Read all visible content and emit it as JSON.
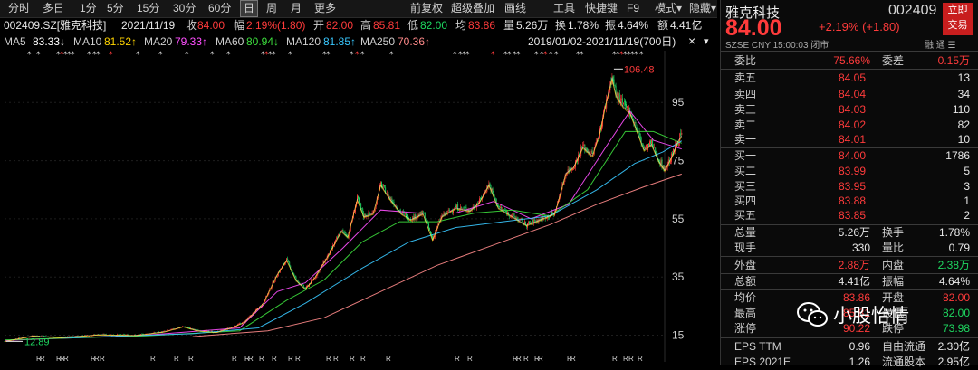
{
  "toolbar": {
    "periods": [
      "分时",
      "多日",
      "1分",
      "5分",
      "15分",
      "30分",
      "60分",
      "日",
      "周",
      "月",
      "更多"
    ],
    "tools": [
      "前复权",
      "超级叠加",
      "画线",
      "工具",
      "快捷键",
      "F9",
      "模式▾",
      "隐藏▾"
    ]
  },
  "info": {
    "code_name": "002409.SZ[雅克科技]",
    "date": "2021/11/19",
    "close_label": "收",
    "close": "84.00",
    "change_label": "幅",
    "change": "2.19%(1.80)",
    "open_label": "开",
    "open": "82.00",
    "high_label": "高",
    "high": "85.81",
    "low_label": "低",
    "low": "82.00",
    "avg_label": "均",
    "avg": "83.86",
    "volume_label": "量",
    "volume": "5.26万",
    "turnover_label": "换",
    "turnover": "1.78%",
    "amplitude_label": "振",
    "amplitude": "4.64%",
    "amount_label": "额",
    "amount": "4.41亿",
    "range": "2019/01/02-2021/11/19(700日)"
  },
  "ma": [
    {
      "label": "MA5",
      "value": "83.33↓"
    },
    {
      "label": "MA10",
      "value": "81.52↑"
    },
    {
      "label": "MA20",
      "value": "79.33↑"
    },
    {
      "label": "MA60",
      "value": "80.94↓"
    },
    {
      "label": "MA120",
      "value": "81.85↑"
    },
    {
      "label": "MA250",
      "value": "70.36↑"
    }
  ],
  "icons": {
    "close": "×",
    "chevron": "▾",
    "collapse": "»"
  },
  "colors": {
    "up": "#ff3b3b",
    "down": "#1ed760",
    "ma5": "#ffffff",
    "ma10": "#ffd400",
    "ma20": "#ff4fff",
    "ma60": "#3cdc3c",
    "ma120": "#39c8ff",
    "ma250": "#ff8a8a"
  },
  "chart_data": {
    "type": "candlestick",
    "y_ticks": [
      15,
      35,
      55,
      75,
      95
    ],
    "ylim": [
      10.5,
      110
    ],
    "x_range": [
      "2019/01/02",
      "2021/11/19"
    ],
    "trading_days": 700,
    "annotations": {
      "max": "106.48",
      "min": "12.89"
    },
    "price_path": [
      [
        0,
        12.9
      ],
      [
        30,
        14.8
      ],
      [
        60,
        14.2
      ],
      [
        100,
        15.2
      ],
      [
        140,
        15.0
      ],
      [
        170,
        16.2
      ],
      [
        190,
        18.0
      ],
      [
        205,
        16.6
      ],
      [
        225,
        16.0
      ],
      [
        240,
        17.5
      ],
      [
        255,
        19.5
      ],
      [
        275,
        26
      ],
      [
        290,
        36
      ],
      [
        300,
        41
      ],
      [
        310,
        34
      ],
      [
        320,
        31
      ],
      [
        330,
        35
      ],
      [
        345,
        43
      ],
      [
        358,
        51
      ],
      [
        365,
        49
      ],
      [
        375,
        62
      ],
      [
        382,
        56
      ],
      [
        392,
        57
      ],
      [
        400,
        67
      ],
      [
        410,
        62
      ],
      [
        422,
        57
      ],
      [
        432,
        55
      ],
      [
        445,
        57
      ],
      [
        455,
        48
      ],
      [
        465,
        56
      ],
      [
        480,
        59
      ],
      [
        495,
        58
      ],
      [
        505,
        61
      ],
      [
        515,
        67
      ],
      [
        525,
        59
      ],
      [
        540,
        56
      ],
      [
        555,
        53
      ],
      [
        570,
        55
      ],
      [
        585,
        57
      ],
      [
        597,
        71
      ],
      [
        605,
        73
      ],
      [
        615,
        80
      ],
      [
        625,
        77
      ],
      [
        633,
        85
      ],
      [
        640,
        96
      ],
      [
        646,
        104
      ],
      [
        650,
        98
      ],
      [
        658,
        94
      ],
      [
        665,
        92
      ],
      [
        672,
        86
      ],
      [
        680,
        79
      ],
      [
        688,
        81
      ],
      [
        696,
        75
      ],
      [
        702,
        72
      ],
      [
        710,
        77
      ],
      [
        716,
        82
      ],
      [
        720,
        84
      ]
    ],
    "ma_paths": {
      "ma20": [
        [
          0,
          13.2
        ],
        [
          150,
          15.0
        ],
        [
          250,
          17.5
        ],
        [
          290,
          30
        ],
        [
          320,
          33
        ],
        [
          360,
          45
        ],
        [
          400,
          58
        ],
        [
          440,
          57
        ],
        [
          480,
          57
        ],
        [
          520,
          61
        ],
        [
          560,
          55
        ],
        [
          600,
          60
        ],
        [
          640,
          80
        ],
        [
          665,
          92
        ],
        [
          690,
          82
        ],
        [
          720,
          79
        ]
      ],
      "ma60": [
        [
          0,
          13.4
        ],
        [
          150,
          14.8
        ],
        [
          250,
          16.5
        ],
        [
          300,
          27
        ],
        [
          340,
          34
        ],
        [
          380,
          47
        ],
        [
          420,
          54
        ],
        [
          460,
          54
        ],
        [
          500,
          57
        ],
        [
          540,
          58
        ],
        [
          580,
          56
        ],
        [
          620,
          65
        ],
        [
          660,
          85
        ],
        [
          690,
          85
        ],
        [
          720,
          81
        ]
      ],
      "ma120": [
        [
          60,
          14.0
        ],
        [
          200,
          15.5
        ],
        [
          270,
          17.5
        ],
        [
          320,
          26
        ],
        [
          380,
          38
        ],
        [
          430,
          47
        ],
        [
          480,
          52
        ],
        [
          530,
          54
        ],
        [
          580,
          56
        ],
        [
          630,
          65
        ],
        [
          670,
          74
        ],
        [
          700,
          78
        ],
        [
          720,
          81.8
        ]
      ],
      "ma250": [
        [
          200,
          14.5
        ],
        [
          280,
          16.5
        ],
        [
          340,
          21
        ],
        [
          400,
          30
        ],
        [
          460,
          39
        ],
        [
          520,
          46
        ],
        [
          580,
          53
        ],
        [
          630,
          60
        ],
        [
          680,
          66
        ],
        [
          720,
          70.4
        ]
      ]
    }
  },
  "panel": {
    "name": "雅克科技",
    "code": "002409",
    "trade_line1": "立即",
    "trade_line2": "交易",
    "price": "84.00",
    "change": "+2.19% (+1.80)",
    "meta": "SZSE  CNY  15:00:03  闭市",
    "badges": "融  通  ☰",
    "weibi": {
      "label": "委比",
      "value": "75.66%"
    },
    "weicha": {
      "label": "委差",
      "value": "0.15万"
    },
    "asks": [
      {
        "label": "卖五",
        "price": "84.05",
        "vol": "13"
      },
      {
        "label": "卖四",
        "price": "84.04",
        "vol": "34"
      },
      {
        "label": "卖三",
        "price": "84.03",
        "vol": "110"
      },
      {
        "label": "卖二",
        "price": "84.02",
        "vol": "82"
      },
      {
        "label": "卖一",
        "price": "84.01",
        "vol": "10"
      }
    ],
    "bids": [
      {
        "label": "买一",
        "price": "84.00",
        "vol": "1786"
      },
      {
        "label": "买二",
        "price": "83.99",
        "vol": "5"
      },
      {
        "label": "买三",
        "price": "83.95",
        "vol": "3"
      },
      {
        "label": "买四",
        "price": "83.88",
        "vol": "1"
      },
      {
        "label": "买五",
        "price": "83.85",
        "vol": "2"
      }
    ],
    "stats": [
      {
        "k1": "总量",
        "v1": "5.26万",
        "k2": "换手",
        "v2": "1.78%"
      },
      {
        "k1": "现手",
        "v1": "330",
        "k2": "量比",
        "v2": "0.79"
      },
      {
        "k1": "外盘",
        "v1": "2.88万",
        "k2": "内盘",
        "v2": "2.38万"
      },
      {
        "k1": "总额",
        "v1": "4.41亿",
        "k2": "振幅",
        "v2": "4.64%"
      },
      {
        "k1": "均价",
        "v1": "83.86",
        "k2": "开盘",
        "v2": "82.00"
      },
      {
        "k1": "最高",
        "v1": "85.81",
        "k2": "最低",
        "v2": "82.00"
      },
      {
        "k1": "涨停",
        "v1": "90.22",
        "k2": "跌停",
        "v2": "73.98"
      },
      {
        "k1": "EPS TTM",
        "v1": "0.96",
        "k2": "自由流通",
        "v2": "2.30亿"
      },
      {
        "k1": "EPS 2021E",
        "v1": "1.26",
        "k2": "流通股本",
        "v2": "2.95亿"
      }
    ]
  },
  "watermark": "小股怡情"
}
